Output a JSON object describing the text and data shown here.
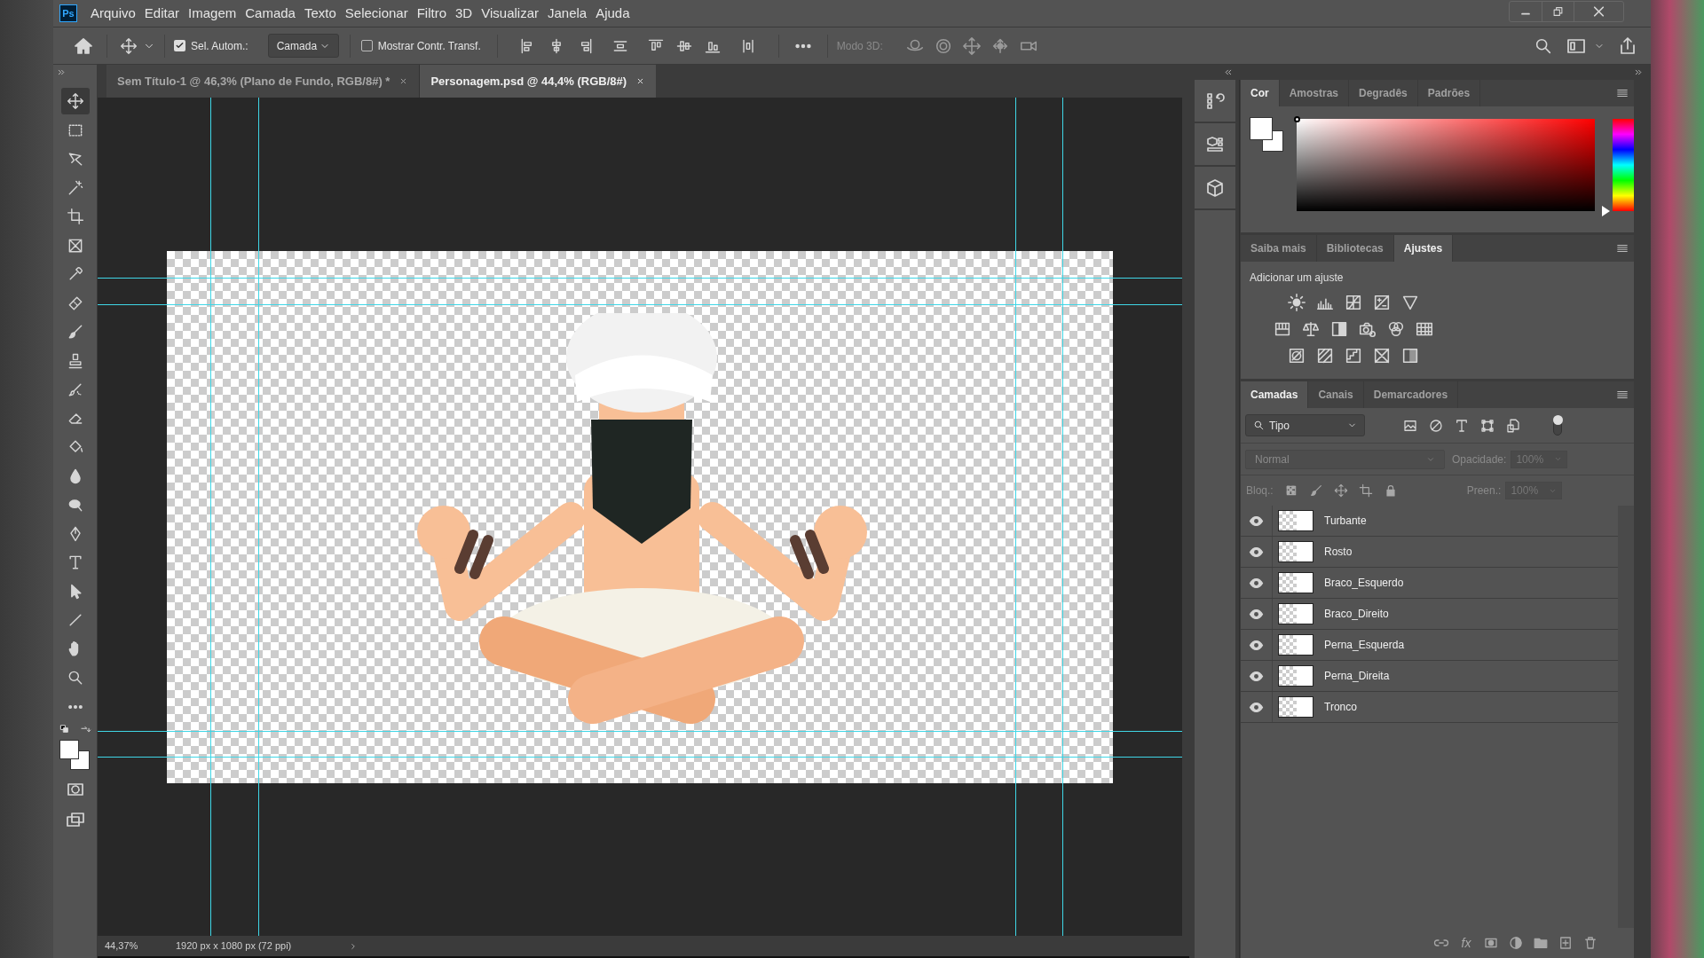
{
  "menu": {
    "app_icon": "Ps",
    "items": [
      "Arquivo",
      "Editar",
      "Imagem",
      "Camada",
      "Texto",
      "Selecionar",
      "Filtro",
      "3D",
      "Visualizar",
      "Janela",
      "Ajuda"
    ]
  },
  "options_bar": {
    "auto_select": {
      "label": "Sel. Autom.:",
      "checked": true
    },
    "auto_select_target": "Camada",
    "transform_controls": {
      "label": "Mostrar Contr. Transf.",
      "checked": false
    },
    "mode_3d_label": "Modo 3D:"
  },
  "document_tabs": [
    {
      "title": "Sem Título-1 @ 46,3% (Plano de Fundo, RGB/8#) *",
      "selected": false
    },
    {
      "title": "Personagem.psd @ 44,4% (RGB/8#)",
      "selected": true
    }
  ],
  "color_panel": {
    "hue_slider": {
      "level": 0
    },
    "tabs": [
      {
        "label": "Cor",
        "selected": true
      },
      {
        "label": "Amostras",
        "selected": false
      },
      {
        "label": "Degradês",
        "selected": false
      },
      {
        "label": "Padrões",
        "selected": false
      }
    ]
  },
  "adjustments_panel": {
    "tabs": [
      {
        "label": "Saiba mais",
        "selected": false
      },
      {
        "label": "Bibliotecas",
        "selected": false
      },
      {
        "label": "Ajustes",
        "selected": true
      }
    ],
    "heading": "Adicionar um ajuste"
  },
  "layers_panel": {
    "tabs": [
      {
        "label": "Camadas",
        "selected": true
      },
      {
        "label": "Canais",
        "selected": false
      },
      {
        "label": "Demarcadores",
        "selected": false
      }
    ],
    "filter": "Tipo",
    "blend_mode": "Normal",
    "opacity_label": "Opacidade:",
    "opacity": "100%",
    "lock_label": "Bloq.:",
    "fill_label": "Preen.:",
    "fill": "100%",
    "layers": [
      {
        "name": "Turbante",
        "visible": true
      },
      {
        "name": "Rosto",
        "visible": true
      },
      {
        "name": "Braco_Esquerdo",
        "visible": true
      },
      {
        "name": "Braco_Direito",
        "visible": true
      },
      {
        "name": "Perna_Esquerda",
        "visible": true
      },
      {
        "name": "Perna_Direita",
        "visible": true
      },
      {
        "name": "Tronco",
        "visible": true
      }
    ],
    "footer_fx": "fx"
  },
  "status_bar": {
    "zoom": "44,37%",
    "document_info": "1920 px x 1080 px (72 ppi)"
  }
}
